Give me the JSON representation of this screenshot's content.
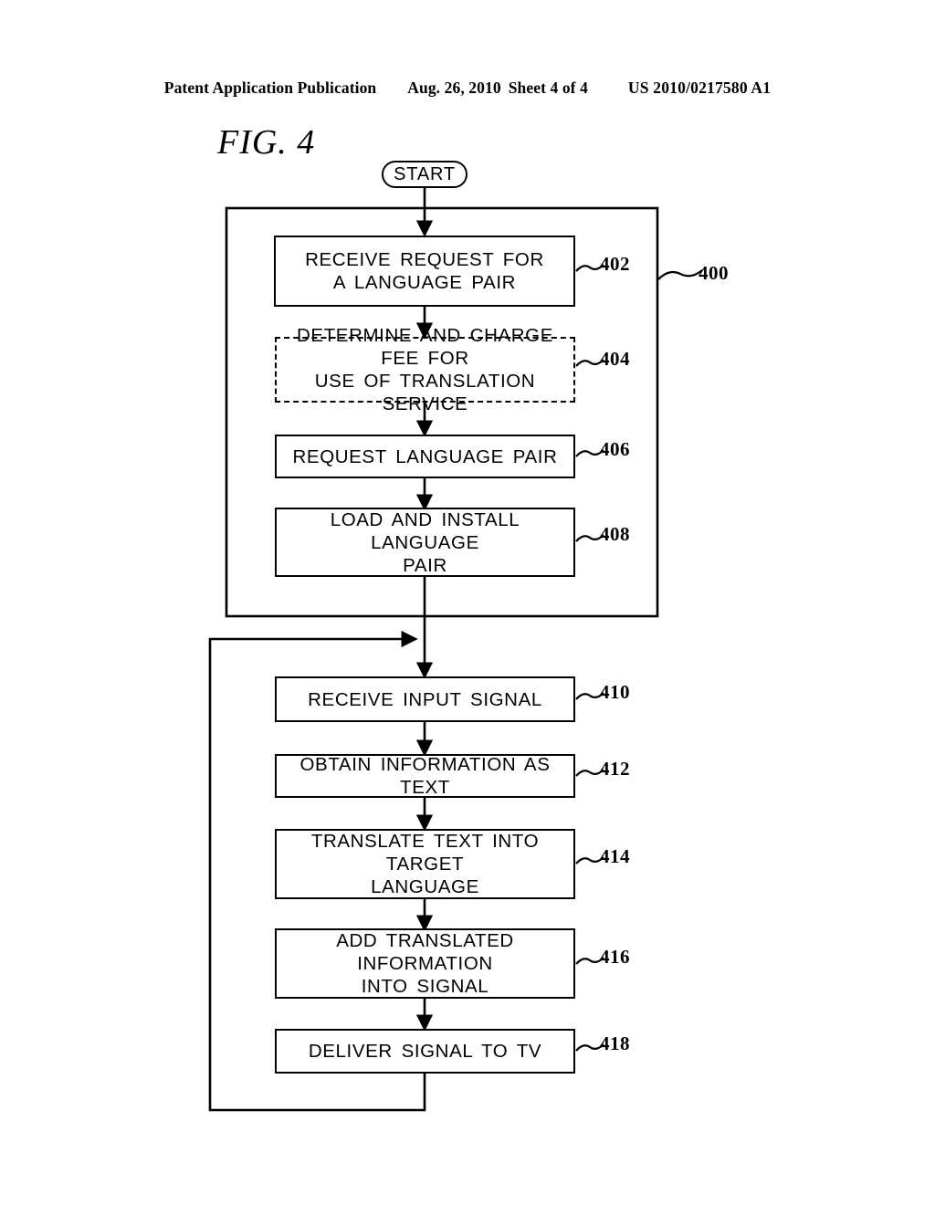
{
  "header": {
    "publication": "Patent Application Publication",
    "date": "Aug. 26, 2010",
    "sheet": "Sheet 4 of 4",
    "publication_number": "US 2010/0217580 A1"
  },
  "figure": {
    "label": "FIG. 4",
    "terminator": {
      "label": "START"
    },
    "group_ref": "400",
    "steps": [
      {
        "ref": "402",
        "label": "RECEIVE REQUEST FOR\nA LANGUAGE PAIR",
        "style": "solid"
      },
      {
        "ref": "404",
        "label": "DETERMINE AND CHARGE FEE FOR\nUSE OF TRANSLATION SERVICE",
        "style": "dashed"
      },
      {
        "ref": "406",
        "label": "REQUEST LANGUAGE PAIR",
        "style": "solid"
      },
      {
        "ref": "408",
        "label": "LOAD AND INSTALL LANGUAGE\nPAIR",
        "style": "solid"
      },
      {
        "ref": "410",
        "label": "RECEIVE INPUT SIGNAL",
        "style": "solid"
      },
      {
        "ref": "412",
        "label": "OBTAIN INFORMATION AS TEXT",
        "style": "solid"
      },
      {
        "ref": "414",
        "label": "TRANSLATE TEXT INTO TARGET\nLANGUAGE",
        "style": "solid"
      },
      {
        "ref": "416",
        "label": "ADD TRANSLATED INFORMATION\nINTO SIGNAL",
        "style": "solid"
      },
      {
        "ref": "418",
        "label": "DELIVER SIGNAL TO TV",
        "style": "solid"
      }
    ]
  },
  "colors": {
    "ink": "#000000",
    "paper": "#ffffff"
  }
}
